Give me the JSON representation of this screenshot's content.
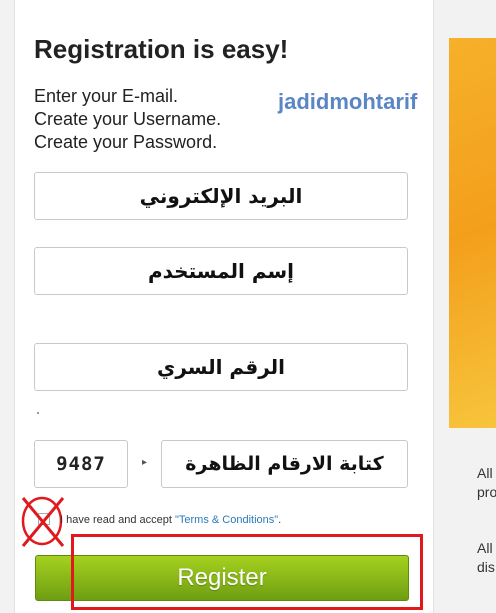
{
  "header": {
    "title": "Registration is easy!",
    "intro": [
      "Enter your E-mail.",
      "Create your Username.",
      "Create your Password."
    ],
    "watermark": "jadidmohtarif"
  },
  "form": {
    "email_placeholder": "البريد الإلكتروني",
    "username_placeholder": "إسم المستخدم",
    "password_placeholder": "الرقم السري",
    "captcha_code": "9487",
    "captcha_placeholder": "كتابة الارقام الظاهرة",
    "terms_prefix": "I have read and accept",
    "terms_link": "\"Terms & Conditions\"",
    "terms_suffix": ".",
    "register_label": "Register"
  },
  "sidebar": {
    "snippets": [
      "All",
      "pro",
      "All",
      "dis"
    ]
  },
  "colors": {
    "register_green": "#7fb016",
    "highlight_red": "#e0191d",
    "watermark_blue": "#5b86c4",
    "right_orange": "#f39f1c"
  }
}
